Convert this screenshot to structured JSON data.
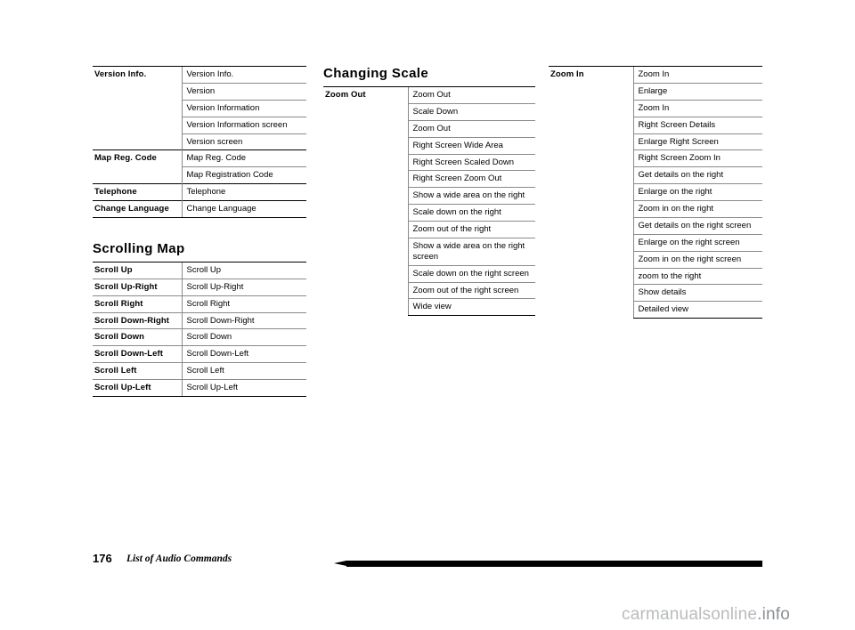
{
  "footer": {
    "page_number": "176",
    "title": "List of Audio Commands"
  },
  "watermark": {
    "text": "carmanualsonline",
    "suffix": ".info"
  },
  "columns": {
    "col1": {
      "table1": {
        "rows": [
          {
            "key": "Version Info.",
            "value": "Version Info.",
            "rule": "black"
          },
          {
            "key": "",
            "value": "Version",
            "rule": "thin"
          },
          {
            "key": "",
            "value": "Version Information",
            "rule": "thin"
          },
          {
            "key": "",
            "value": "Version Information screen",
            "rule": "thin"
          },
          {
            "key": "",
            "value": "Version screen",
            "rule": "thin"
          },
          {
            "key": "Map Reg. Code",
            "value": "Map Reg. Code",
            "rule": "black"
          },
          {
            "key": "",
            "value": "Map Registration Code",
            "rule": "thin"
          },
          {
            "key": "Telephone",
            "value": "Telephone",
            "rule": "black"
          },
          {
            "key": "Change Language",
            "value": "Change Language",
            "rule": "black"
          }
        ]
      },
      "heading2": "Scrolling Map",
      "table2": {
        "rows": [
          {
            "key": "Scroll Up",
            "value": "Scroll Up",
            "rule": "black"
          },
          {
            "key": "Scroll Up-Right",
            "value": "Scroll Up-Right",
            "rule": "thin"
          },
          {
            "key": "Scroll Right",
            "value": "Scroll Right",
            "rule": "thin"
          },
          {
            "key": "Scroll Down-Right",
            "value": "Scroll Down-Right",
            "rule": "thin"
          },
          {
            "key": "Scroll Down",
            "value": "Scroll Down",
            "rule": "thin"
          },
          {
            "key": "Scroll Down-Left",
            "value": "Scroll Down-Left",
            "rule": "thin"
          },
          {
            "key": "Scroll Left",
            "value": "Scroll Left",
            "rule": "thin"
          },
          {
            "key": "Scroll Up-Left",
            "value": "Scroll Up-Left",
            "rule": "thin"
          }
        ]
      }
    },
    "col2": {
      "heading1": "Changing Scale",
      "table1": {
        "key": "Zoom Out",
        "values": [
          "Zoom Out",
          "Scale Down",
          "Zoom Out",
          "Right Screen Wide Area",
          "Right Screen Scaled Down",
          "Right Screen Zoom Out",
          "Show a wide area on the right",
          "Scale down on the right",
          "Zoom out of the right",
          "Show a wide area on the right screen",
          "Scale down on the right screen",
          "Zoom out of the right screen",
          "Wide view"
        ]
      }
    },
    "col3": {
      "table1": {
        "key": "Zoom In",
        "values": [
          "Zoom In",
          "Enlarge",
          "Zoom In",
          "Right Screen Details",
          "Enlarge Right Screen",
          "Right Screen Zoom In",
          "Get details on the right",
          "Enlarge on the right",
          "Zoom in on the right",
          "Get details on the right screen",
          "Enlarge on the right screen",
          "Zoom in on the right screen",
          "zoom to the right",
          "Show details",
          "Detailed view"
        ]
      }
    }
  }
}
